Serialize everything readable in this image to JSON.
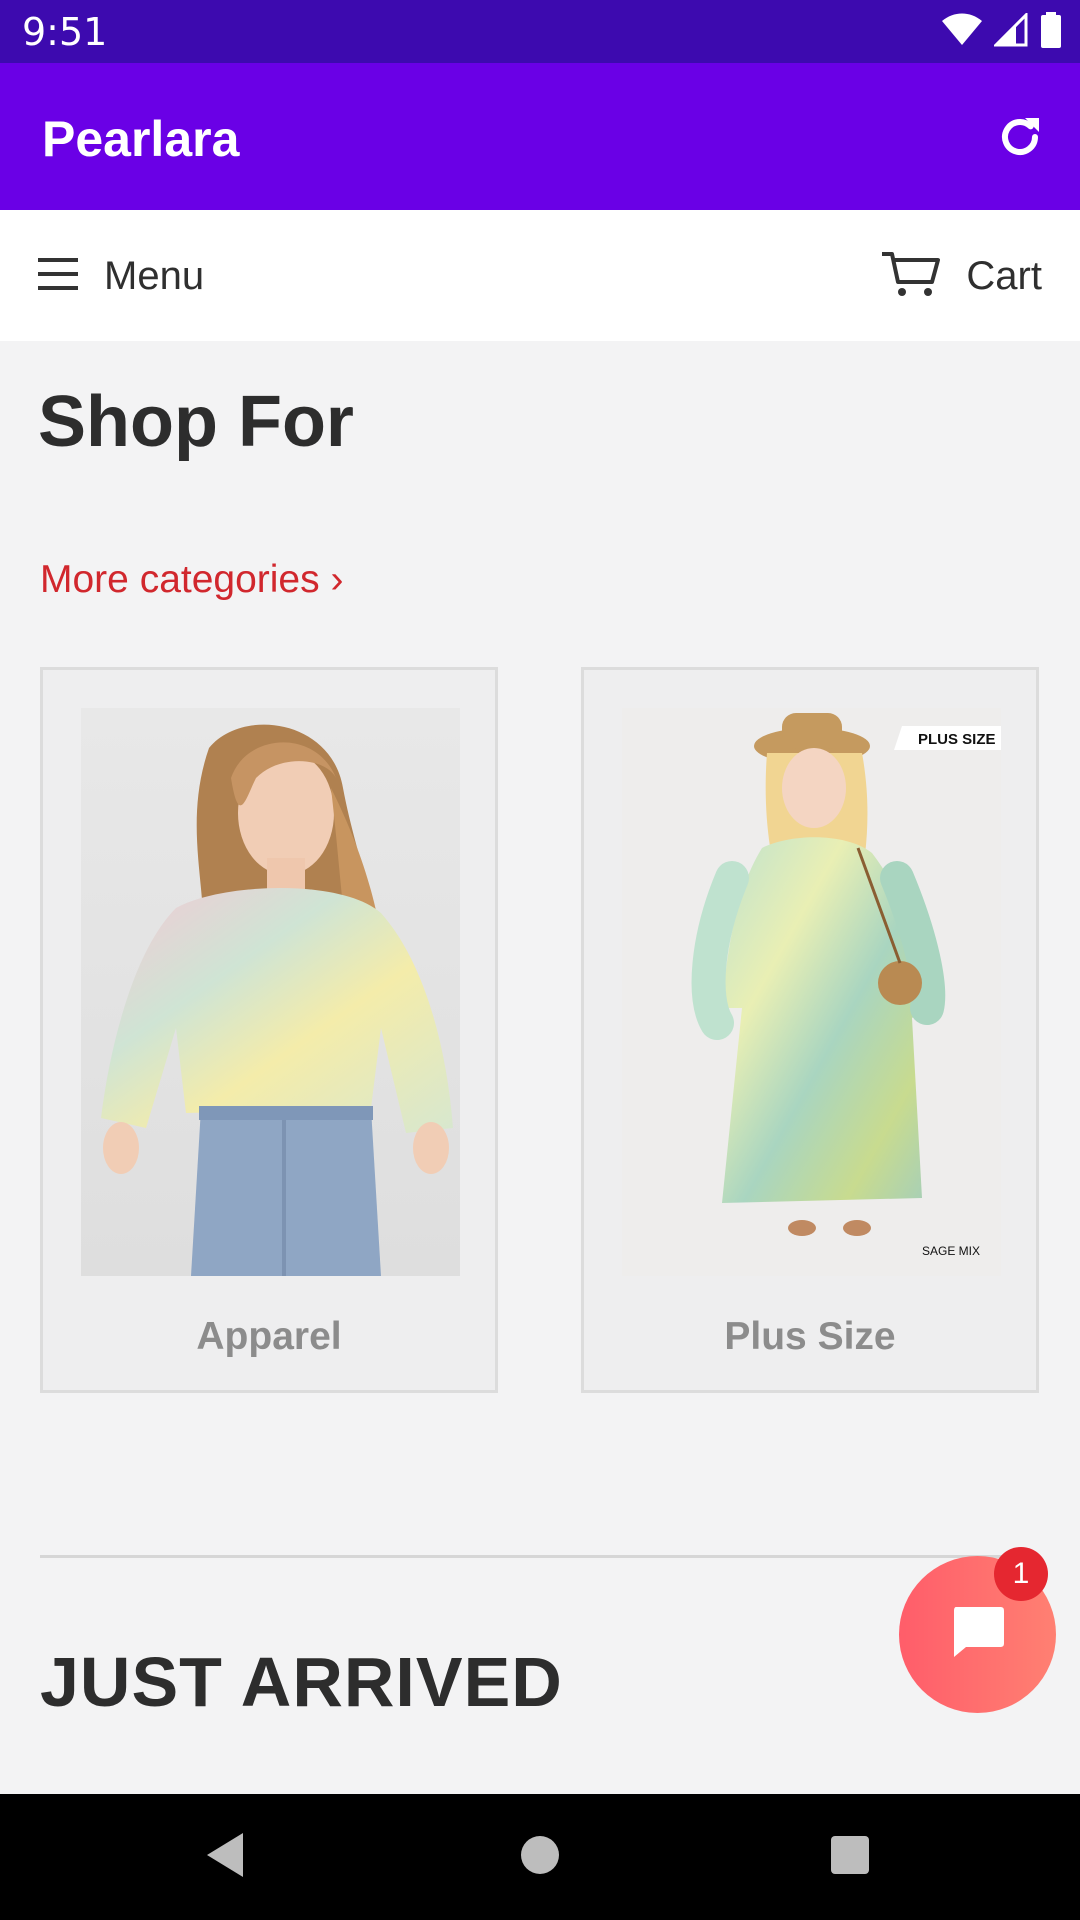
{
  "status_bar": {
    "time": "9:51",
    "icons": [
      "wifi-icon",
      "cellular-signal-icon",
      "battery-icon"
    ]
  },
  "app_bar": {
    "title": "Pearlara",
    "refresh_icon": "refresh-icon"
  },
  "nav_bar": {
    "menu_label": "Menu",
    "cart_label": "Cart"
  },
  "main": {
    "title": "Shop For",
    "more_link": "More categories ›",
    "categories": [
      {
        "label": "Apparel"
      },
      {
        "label": "Plus Size",
        "image_tags": [
          "PLUS SIZE",
          "SAGE MIX"
        ]
      }
    ],
    "section_title": "JUST ARRIVED"
  },
  "chat": {
    "badge_count": "1",
    "icon": "chat-icon"
  },
  "system_nav": {
    "icons": [
      "back-icon",
      "home-icon",
      "recents-icon"
    ]
  },
  "colors": {
    "status_bar": "#3d0aaf",
    "app_bar": "#6a00e6",
    "link": "#d1272d",
    "chat": "#ff6b6e",
    "badge": "#e52730"
  }
}
